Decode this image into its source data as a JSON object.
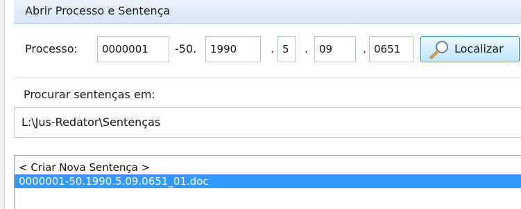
{
  "window": {
    "title": "Abrir Processo e Sentença"
  },
  "process": {
    "label": "Processo:",
    "number": "0000001",
    "check_digits": "-50.",
    "year": "1990",
    "sep1": ".",
    "segment": "5",
    "sep2": ".",
    "tribunal": "09",
    "sep3": ".",
    "origin": "0651"
  },
  "find_button": {
    "label": "Localizar",
    "icon": "magnifier-icon"
  },
  "search_in": {
    "label": "Procurar sentenças em:",
    "path": "L:\\Jus-Redator\\Sentenças"
  },
  "files": {
    "items": [
      {
        "label": "< Criar Nova Sentença >",
        "selected": false
      },
      {
        "label": "0000001-50.1990.5.09.0651_01.doc",
        "selected": true
      }
    ]
  },
  "colors": {
    "selection": "#3399ff",
    "title_bar": "#dbe7f6",
    "button_border": "#3c7fb1"
  }
}
